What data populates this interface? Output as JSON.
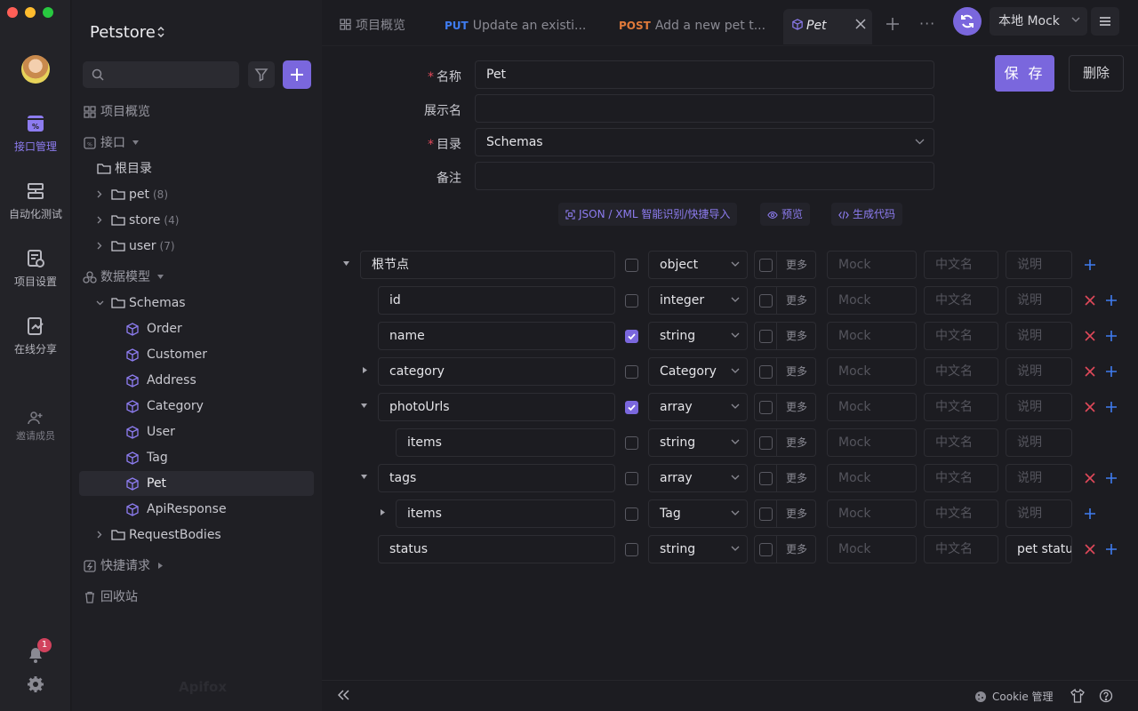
{
  "sidebar": {
    "project_name": "Petstore",
    "search_placeholder": "",
    "items": {
      "overview": "项目概览",
      "interfaces": "接口",
      "root": "根目录",
      "pet": "pet",
      "pet_count": "(8)",
      "store": "store",
      "store_count": "(4)",
      "user": "user",
      "user_count": "(7)",
      "data_models": "数据模型",
      "schemas": "Schemas",
      "order": "Order",
      "customer": "Customer",
      "address": "Address",
      "category": "Category",
      "user_model": "User",
      "tag": "Tag",
      "pet_model": "Pet",
      "api_response": "ApiResponse",
      "request_bodies": "RequestBodies",
      "quick_request": "快捷请求",
      "trash": "回收站"
    },
    "watermark": "Apifox"
  },
  "rail": {
    "api_mgmt": "接口管理",
    "auto_test": "自动化测试",
    "project_settings": "项目设置",
    "online_share": "在线分享",
    "invite": "邀请成员",
    "notification_count": "1"
  },
  "tabs": [
    {
      "method": "",
      "label": "项目概览"
    },
    {
      "method": "PUT",
      "label": "Update an existi..."
    },
    {
      "method": "POST",
      "label": "Add a new pet t..."
    },
    {
      "method": "",
      "label": "Pet"
    }
  ],
  "env": "本地 Mock",
  "form": {
    "name_label": "名称",
    "name_value": "Pet",
    "display_label": "展示名",
    "display_value": "",
    "dir_label": "目录",
    "dir_value": "Schemas",
    "note_label": "备注",
    "note_value": "",
    "save": "保 存",
    "delete": "删除"
  },
  "tools": {
    "import": "JSON / XML 智能识别/快捷导入",
    "preview": "预览",
    "codegen": "生成代码"
  },
  "schema": {
    "more": "更多",
    "mock_ph": "Mock",
    "cn_ph": "中文名",
    "desc_ph": "说明",
    "rows": [
      {
        "name": "根节点",
        "type": "object",
        "desc": ""
      },
      {
        "name": "id",
        "type": "integer",
        "desc": ""
      },
      {
        "name": "name",
        "type": "string",
        "desc": ""
      },
      {
        "name": "category",
        "type": "Category",
        "desc": ""
      },
      {
        "name": "photoUrls",
        "type": "array",
        "desc": ""
      },
      {
        "name": "items",
        "type": "string",
        "desc": ""
      },
      {
        "name": "tags",
        "type": "array",
        "desc": ""
      },
      {
        "name": "items",
        "type": "Tag",
        "desc": ""
      },
      {
        "name": "status",
        "type": "string",
        "desc": "pet status"
      }
    ]
  },
  "bottom": {
    "cookie": "Cookie 管理"
  },
  "colors": {
    "accent": "#7a67dd",
    "put": "#3f7cf0",
    "post": "#e07a3a",
    "danger": "#e0485a",
    "bg": "#1c1c21"
  }
}
